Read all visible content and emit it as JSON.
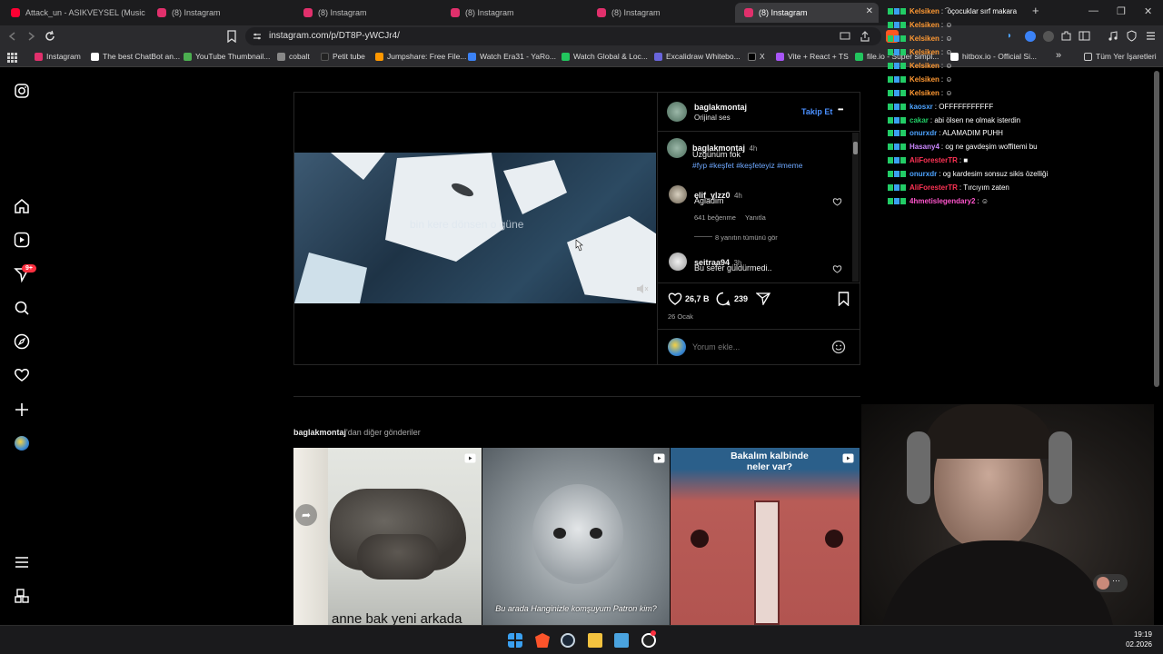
{
  "tabs": [
    {
      "label": "Attack_un - ASIKVEYSEL (Music Vide",
      "color": "#ff0033"
    },
    {
      "label": "(8) Instagram",
      "color": "#e1306c"
    },
    {
      "label": "(8) Instagram",
      "color": "#e1306c"
    },
    {
      "label": "(8) Instagram",
      "color": "#e1306c"
    },
    {
      "label": "(8) Instagram",
      "color": "#e1306c"
    },
    {
      "label": "(8) Instagram",
      "color": "#e1306c"
    }
  ],
  "tab_close": "✕",
  "new_tab": "+",
  "window": {
    "minimize": "—",
    "maximize": "❐",
    "close": "✕"
  },
  "url": "instagram.com/p/DT8P-yWCJr4/",
  "bookmarks": [
    {
      "label": "Instagram",
      "color": "#e1306c"
    },
    {
      "label": "The best ChatBot an...",
      "color": "#ffffff"
    },
    {
      "label": "YouTube Thumbnail...",
      "color": "#4caf50"
    },
    {
      "label": "cobalt",
      "color": "#888888"
    },
    {
      "label": "Petit tube",
      "color": "#222222"
    },
    {
      "label": "Jumpshare: Free File...",
      "color": "#ff9800"
    },
    {
      "label": "Watch Era31 - YaRo...",
      "color": "#3b82f6"
    },
    {
      "label": "Watch Global & Loc...",
      "color": "#22c55e"
    },
    {
      "label": "Excalidraw Whitebo...",
      "color": "#6965db"
    },
    {
      "label": "X",
      "color": "#000000"
    },
    {
      "label": "Vite + React + TS",
      "color": "#a855f7"
    },
    {
      "label": "file.io - Super simpl...",
      "color": "#22c55e"
    },
    {
      "label": "hitbox.io - Official Si...",
      "color": "#ffffff"
    }
  ],
  "bookmarks_more": "»",
  "all_bookmarks": "Tüm Yer İşaretleri",
  "sidebar": {
    "notif_badge": "9+"
  },
  "post": {
    "username": "baglakmontaj",
    "audio": "Orijinal ses",
    "follow": "Takip Et",
    "more": "•••",
    "video_caption": "bin kere dönsen o güne",
    "caption_user": "baglakmontaj",
    "caption_time": "4h",
    "caption_text": "Üzgünüm fok",
    "caption_tags": "#fyp #keşfet #keşfeteyiz #meme",
    "comments": [
      {
        "user": "elif_ylzz0",
        "time": "4h",
        "text": "Agladim",
        "likes": "641 beğenme",
        "reply": "Yanıtla",
        "view_replies": "8 yanıtın tümünü gör"
      },
      {
        "user": "seitraa94",
        "time": "3h",
        "text": "Bu sefer güldürmedi.."
      }
    ],
    "like_count": "26,7 B",
    "comment_count": "239",
    "date": "26 Ocak",
    "comment_placeholder": "Yorum ekle..."
  },
  "more_posts": {
    "user": "baglakmontaj",
    "suffix": "'dan diğer gönderiler"
  },
  "thumbs": [
    {
      "caption": "anne bak yeni arkada"
    },
    {
      "caption": "Bu arada Hanginizle komşuyum Patron kim?"
    },
    {
      "caption": "Bakalım kalbinde neler var?"
    }
  ],
  "chat": [
    {
      "name": "Kelsiken",
      "msg": ": ͡ oçocuklar sırf makara",
      "color": "#ff9933"
    },
    {
      "name": "Kelsiken",
      "msg": ": ☺",
      "color": "#ff9933"
    },
    {
      "name": "Kelsiken",
      "msg": ": ☺",
      "color": "#ff9933"
    },
    {
      "name": "Kelsiken",
      "msg": ": ☺",
      "color": "#ff9933"
    },
    {
      "name": "Kelsiken",
      "msg": ": ☺",
      "color": "#ff9933"
    },
    {
      "name": "Kelsiken",
      "msg": ": ☺",
      "color": "#ff9933"
    },
    {
      "name": "Kelsiken",
      "msg": ": ☺",
      "color": "#ff9933"
    },
    {
      "name": "kaosxr",
      "msg": ": OFFFFFFFFFFF",
      "color": "#4da3ff"
    },
    {
      "name": "cakar",
      "msg": ": abi ölsen ne olmak isterdin",
      "color": "#22cc66"
    },
    {
      "name": "onurxdr",
      "msg": ": ALAMADIM PUHH",
      "color": "#4da3ff"
    },
    {
      "name": "Hasany4",
      "msg": ": og ne gavdeşim woffitemi bu",
      "color": "#cc88ff"
    },
    {
      "name": "AliForesterTR",
      "msg": ": ■",
      "color": "#ff3355"
    },
    {
      "name": "onurxdr",
      "msg": ": og kardesim sonsuz sikis özelliği",
      "color": "#4da3ff"
    },
    {
      "name": "AliForesterTR",
      "msg": ": Tırcıyım zaten",
      "color": "#ff3355"
    },
    {
      "name": "4hmetislegendary2",
      "msg": ": ☺",
      "color": "#ff55cc"
    }
  ],
  "clock": {
    "time": "19:19",
    "date": "02.2026"
  }
}
